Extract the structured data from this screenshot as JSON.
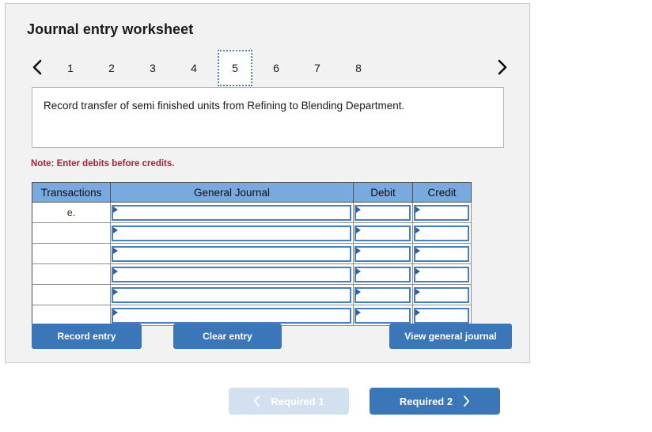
{
  "card": {
    "title": "Journal entry worksheet",
    "pager": {
      "prev_icon": "chevron-left-icon",
      "next_icon": "chevron-right-icon",
      "tabs": [
        "1",
        "2",
        "3",
        "4",
        "5",
        "6",
        "7",
        "8"
      ],
      "active_tab": "5"
    },
    "description": "Record transfer of semi finished units from Refining to Blending Department.",
    "note": "Note: Enter debits before credits.",
    "table": {
      "headers": [
        "Transactions",
        "General Journal",
        "Debit",
        "Credit"
      ],
      "rows": [
        {
          "transaction": "e.",
          "general_journal": "",
          "debit": "",
          "credit": ""
        },
        {
          "transaction": "",
          "general_journal": "",
          "debit": "",
          "credit": ""
        },
        {
          "transaction": "",
          "general_journal": "",
          "debit": "",
          "credit": ""
        },
        {
          "transaction": "",
          "general_journal": "",
          "debit": "",
          "credit": ""
        },
        {
          "transaction": "",
          "general_journal": "",
          "debit": "",
          "credit": ""
        },
        {
          "transaction": "",
          "general_journal": "",
          "debit": "",
          "credit": ""
        }
      ]
    },
    "actions": {
      "record": "Record entry",
      "clear": "Clear entry",
      "view": "View general journal"
    }
  },
  "footer_nav": {
    "prev_label": "Required 1",
    "prev_icon": "chevron-left-icon",
    "next_label": "Required 2",
    "next_icon": "chevron-right-icon"
  },
  "colors": {
    "page_background": "#ffffff",
    "card_background": "#f2f2f2",
    "card_border": "#c8c8c8",
    "table_header_blue": "#7aa9e0",
    "input_border_blue": "#4a7ebb",
    "button_blue": "#3a76b8",
    "button_disabled_blue": "#d3e0f0",
    "note_red": "#a8213c",
    "active_tab_border": "#4f81bd"
  }
}
